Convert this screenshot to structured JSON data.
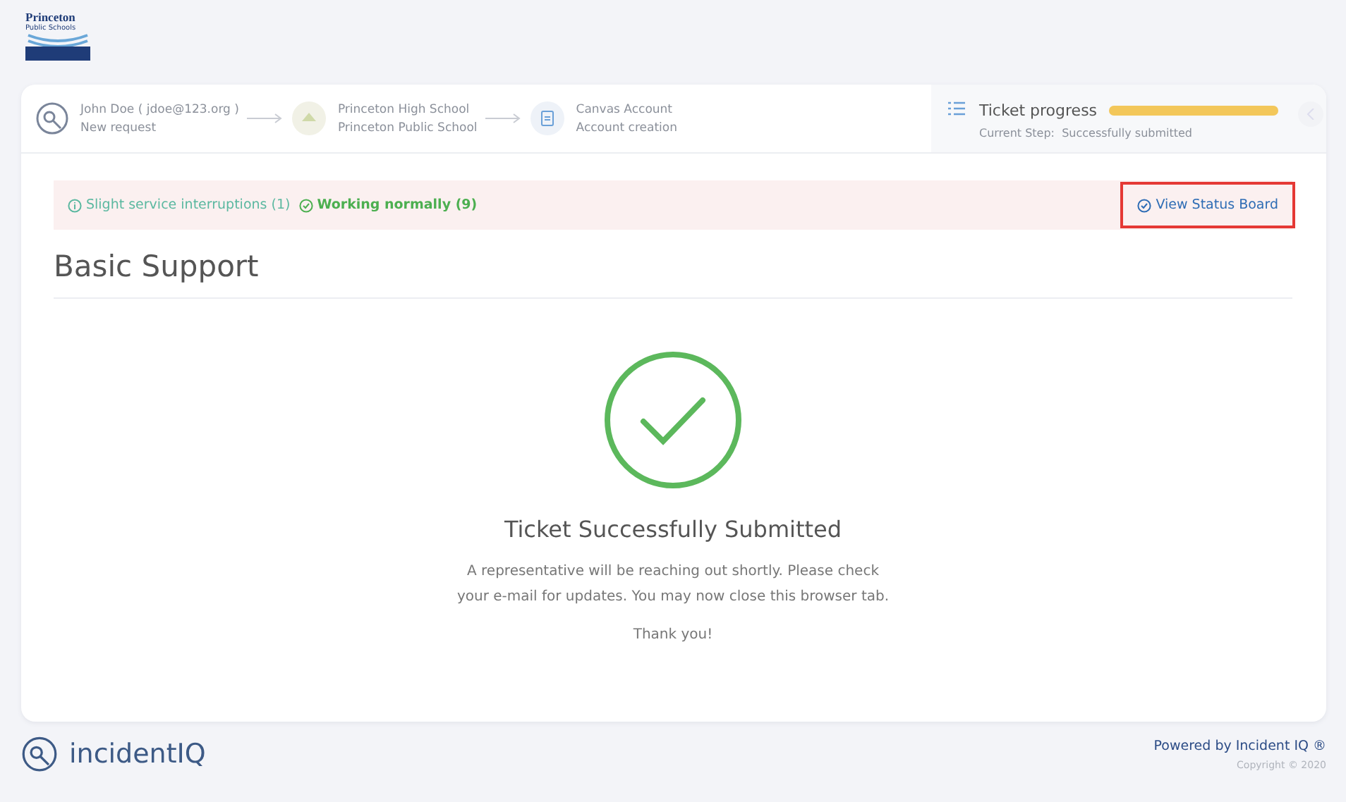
{
  "logo": {
    "line_1": "Princeton",
    "line_2": "Public Schools"
  },
  "breadcrumb": [
    {
      "kind": "user",
      "title": "John Doe ( jdoe@123.org )",
      "subtitle": "New request"
    },
    {
      "kind": "school",
      "title": "Princeton High School",
      "subtitle": "Princeton Public School"
    },
    {
      "kind": "clipboard",
      "title": "Canvas Account",
      "subtitle": "Account creation"
    }
  ],
  "progress": {
    "title": "Ticket progress",
    "level": 1,
    "step_label": "Current Step:",
    "step": "Successfully submitted"
  },
  "status": {
    "items": [
      {
        "kind": "warning",
        "text": "Slight service interruptions (1)",
        "color": "#5bb8a0"
      },
      {
        "kind": "ok",
        "text": "Working normally (9)",
        "color": "#4caf50"
      }
    ],
    "link": "View Status Board",
    "highlighted": true
  },
  "page_title": "Basic Support",
  "result": {
    "title": "Ticket Successfully Submitted",
    "message": "A representative will be reaching out shortly.  Please check your e-mail for updates.  You may now close this browser tab.",
    "thanks": "Thank you!"
  },
  "footer": {
    "brand": "incidentIQ",
    "powered": "Powered by Incident IQ ®",
    "copyright": "Copyright © 2020"
  }
}
